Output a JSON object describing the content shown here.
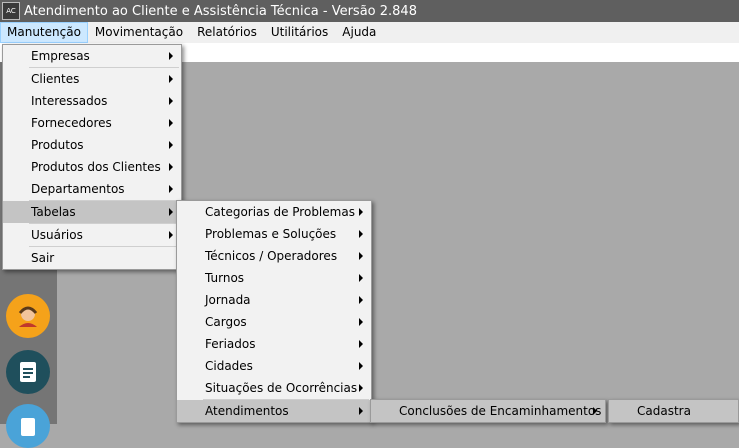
{
  "window": {
    "title": "Atendimento ao Cliente e Assistência Técnica - Versão 2.848",
    "icon_label": "AC"
  },
  "menubar": [
    "Manutenção",
    "Movimentação",
    "Relatórios",
    "Utilitários",
    "Ajuda"
  ],
  "menu_manutencao": [
    "Empresas",
    "Clientes",
    "Interessados",
    "Fornecedores",
    "Produtos",
    "Produtos dos Clientes",
    "Departamentos",
    "Tabelas",
    "Usuários",
    "Sair"
  ],
  "menu_tabelas": [
    "Categorias de Problemas",
    "Problemas e Soluções",
    "Técnicos / Operadores",
    "Turnos",
    "Jornada",
    "Cargos",
    "Feriados",
    "Cidades",
    "Situações de Ocorrências",
    "Atendimentos"
  ],
  "menu_atendimentos": [
    "Conclusões de Encaminhamentos"
  ],
  "menu_conclusoes": [
    "Cadastra"
  ],
  "rail_icons": [
    "user-support-icon",
    "document-icon",
    "document2-icon"
  ],
  "colors": {
    "selected_row": "#c4c4c4",
    "menu_bg": "#f2f2f2",
    "title_bg": "#5f5f5f"
  }
}
